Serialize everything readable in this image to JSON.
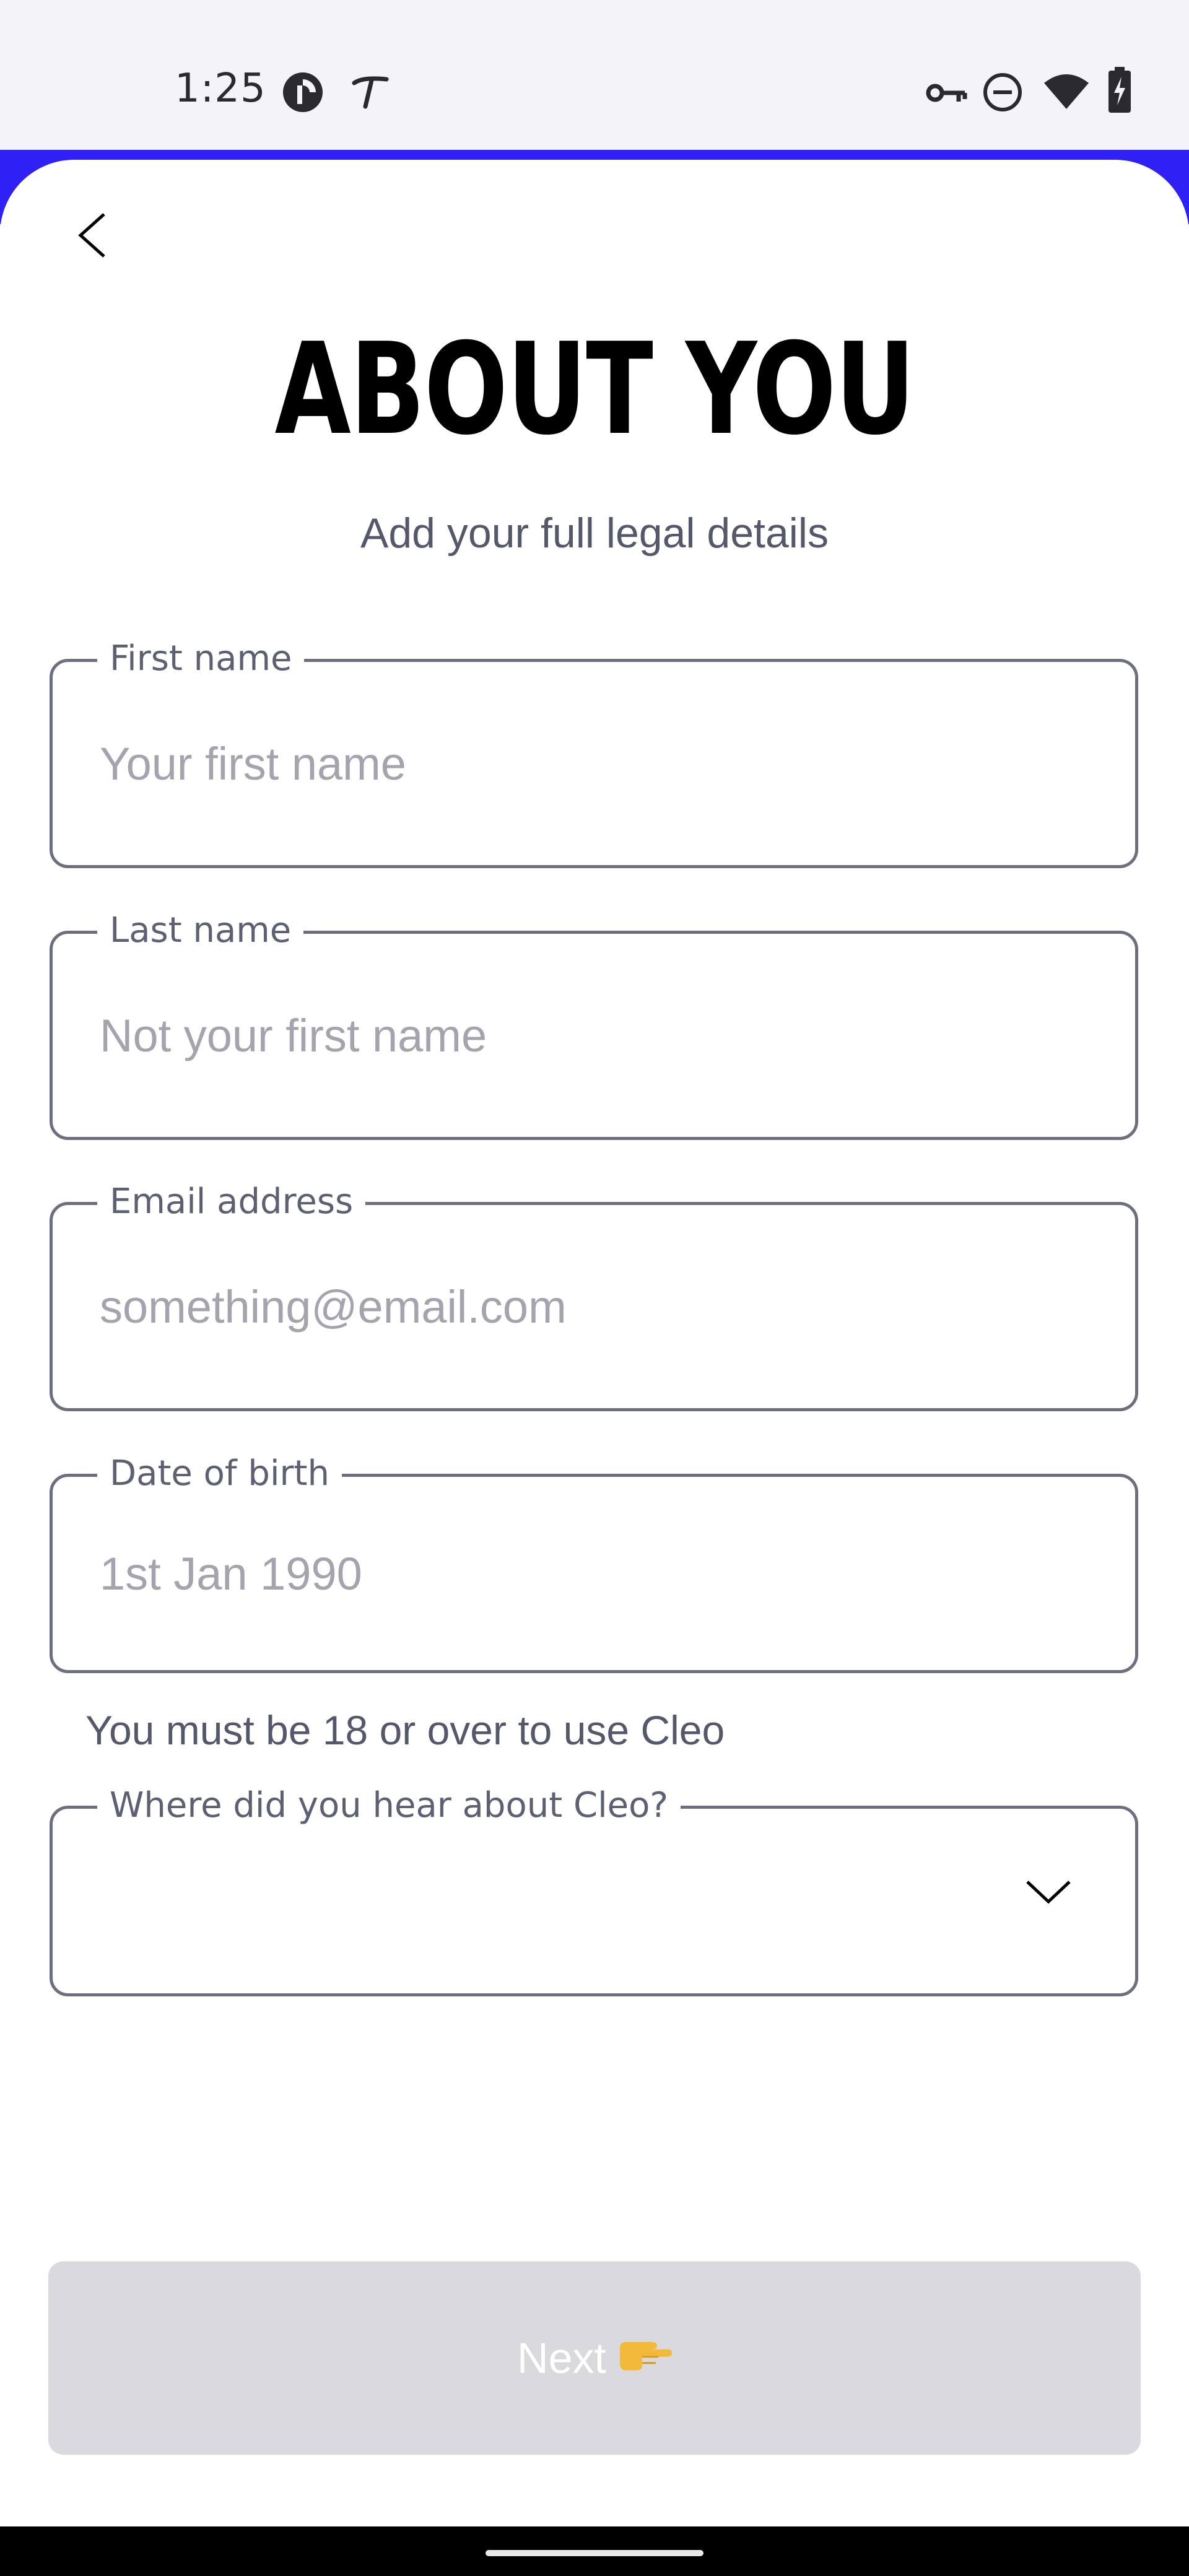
{
  "status_bar": {
    "time": "1:25",
    "left_icons": [
      "pocket-casts-icon",
      "tasks-t-icon"
    ],
    "right_icons": [
      "vpn-key-icon",
      "do-not-disturb-icon",
      "wifi-icon",
      "battery-charging-icon"
    ]
  },
  "colors": {
    "accent": "#2f20f5",
    "field_border": "#6d6f80",
    "placeholder": "#a3a4ae",
    "button_disabled": "#dadade"
  },
  "header": {
    "back_icon": "back-chevron-icon",
    "title": "ABOUT YOU",
    "subtitle": "Add your full legal details"
  },
  "form": {
    "first_name": {
      "label": "First name",
      "placeholder": "Your first name",
      "value": ""
    },
    "last_name": {
      "label": "Last name",
      "placeholder": "Not your first name",
      "value": ""
    },
    "email": {
      "label": "Email address",
      "placeholder": "something@email.com",
      "value": ""
    },
    "dob": {
      "label": "Date of birth",
      "placeholder": "1st Jan 1990",
      "value": ""
    },
    "dob_helper": "You must be 18 or over to use Cleo",
    "referral": {
      "label": "Where did you hear about Cleo?",
      "value": "",
      "icon": "chevron-down-icon"
    }
  },
  "footer": {
    "next_label": "Next",
    "next_emoji": "👉",
    "next_enabled": false
  }
}
